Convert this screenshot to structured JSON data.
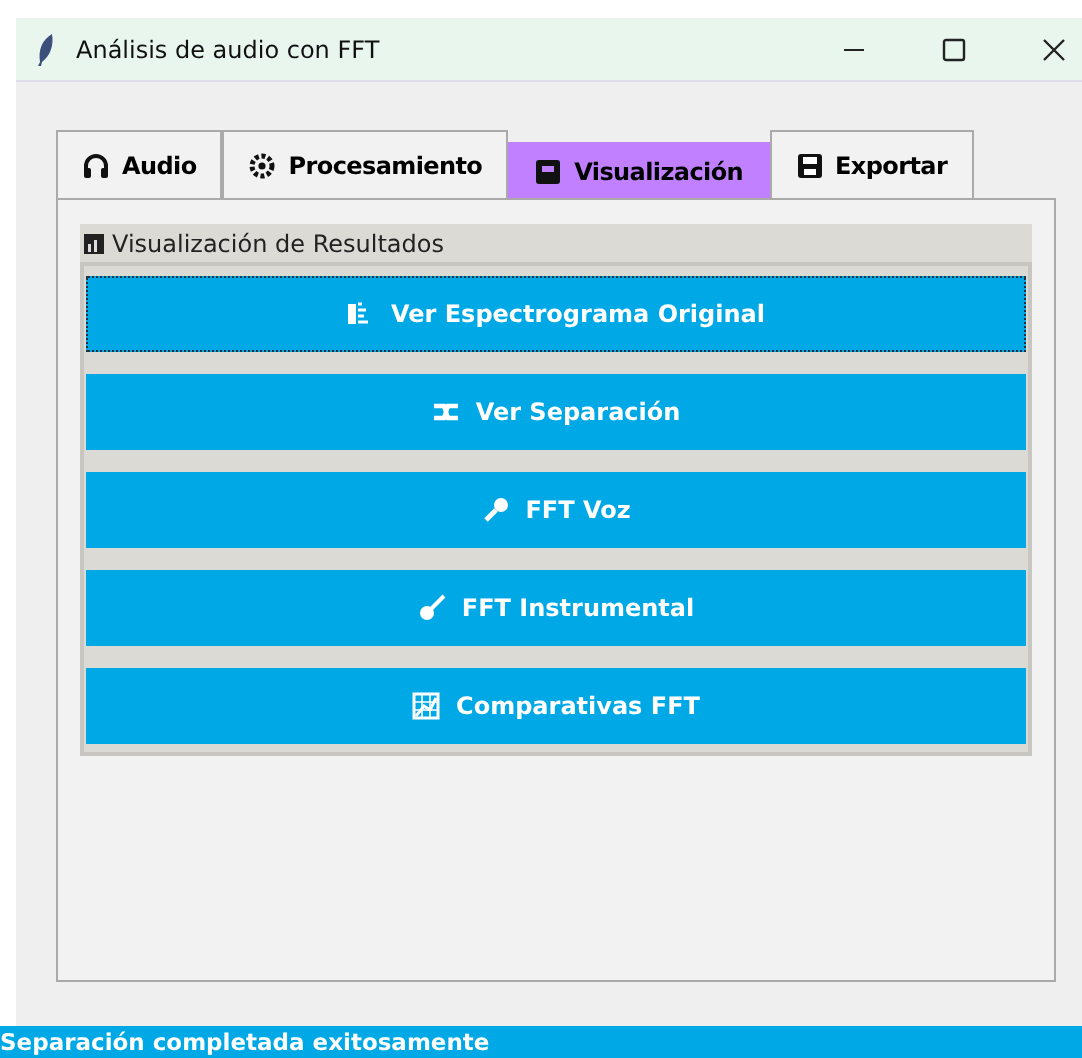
{
  "window": {
    "title": "Análisis de audio con FFT"
  },
  "tabs": [
    {
      "label": "Audio",
      "selected": false
    },
    {
      "label": "Procesamiento",
      "selected": false
    },
    {
      "label": "Visualización",
      "selected": true
    },
    {
      "label": "Exportar",
      "selected": false
    }
  ],
  "section": {
    "title": "Visualización de Resultados"
  },
  "buttons": [
    {
      "label": "Ver Espectrograma Original",
      "focused": true
    },
    {
      "label": "Ver Separación",
      "focused": false
    },
    {
      "label": "FFT Voz",
      "focused": false
    },
    {
      "label": "FFT Instrumental",
      "focused": false
    },
    {
      "label": "Comparativas FFT",
      "focused": false
    }
  ],
  "status_bar": "Separación completada exitosamente"
}
